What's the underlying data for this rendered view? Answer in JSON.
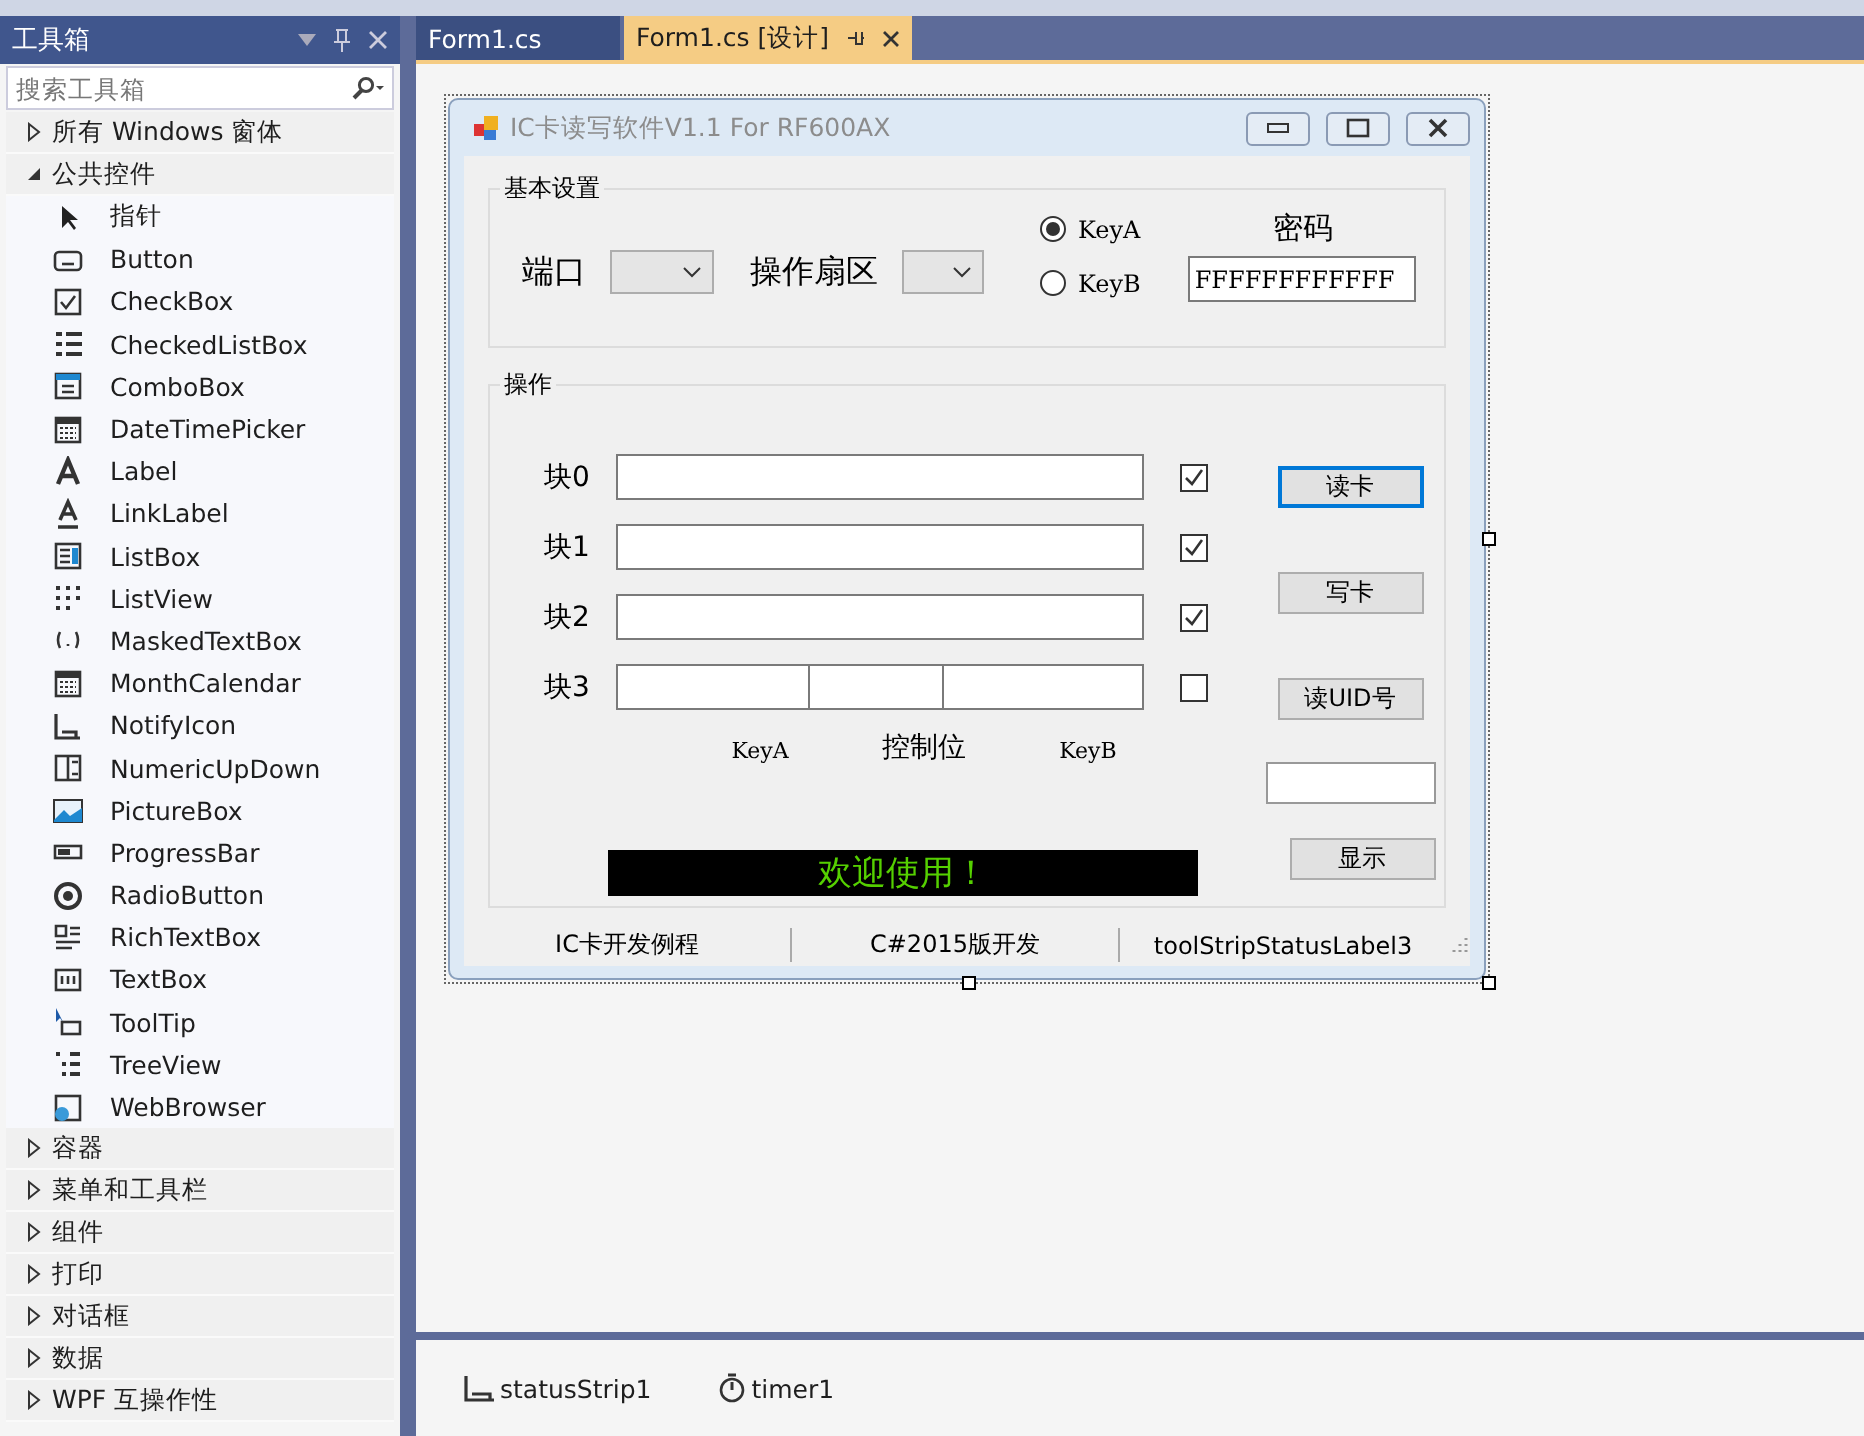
{
  "toolbox": {
    "title": "工具箱",
    "search": {
      "placeholder": "搜索工具箱"
    },
    "groups": [
      {
        "label": "所有 Windows 窗体",
        "expanded": false
      },
      {
        "label": "公共控件",
        "expanded": true,
        "items": [
          {
            "label": "指针"
          },
          {
            "label": "Button"
          },
          {
            "label": "CheckBox"
          },
          {
            "label": "CheckedListBox"
          },
          {
            "label": "ComboBox"
          },
          {
            "label": "DateTimePicker"
          },
          {
            "label": "Label"
          },
          {
            "label": "LinkLabel"
          },
          {
            "label": "ListBox"
          },
          {
            "label": "ListView"
          },
          {
            "label": "MaskedTextBox"
          },
          {
            "label": "MonthCalendar"
          },
          {
            "label": "NotifyIcon"
          },
          {
            "label": "NumericUpDown"
          },
          {
            "label": "PictureBox"
          },
          {
            "label": "ProgressBar"
          },
          {
            "label": "RadioButton"
          },
          {
            "label": "RichTextBox"
          },
          {
            "label": "TextBox"
          },
          {
            "label": "ToolTip"
          },
          {
            "label": "TreeView"
          },
          {
            "label": "WebBrowser"
          }
        ]
      },
      {
        "label": "容器",
        "expanded": false
      },
      {
        "label": "菜单和工具栏",
        "expanded": false
      },
      {
        "label": "组件",
        "expanded": false
      },
      {
        "label": "打印",
        "expanded": false
      },
      {
        "label": "对话框",
        "expanded": false
      },
      {
        "label": "数据",
        "expanded": false
      },
      {
        "label": "WPF 互操作性",
        "expanded": false
      }
    ]
  },
  "tabs": [
    {
      "label": "Form1.cs",
      "selected": false
    },
    {
      "label": "Form1.cs [设计]",
      "selected": true
    }
  ],
  "form": {
    "title": "IC卡读写软件V1.1 For RF600AX",
    "basic_settings": {
      "title": "基本设置",
      "port_label": "端口",
      "sector_label": "操作扇区",
      "key_options": [
        {
          "label": "KeyA",
          "selected": true
        },
        {
          "label": "KeyB",
          "selected": false
        }
      ],
      "password_label": "密码",
      "password_value": "FFFFFFFFFFFF"
    },
    "operation": {
      "title": "操作",
      "blocks": [
        {
          "label": "块0",
          "kind": "single",
          "checked": true
        },
        {
          "label": "块1",
          "kind": "single",
          "checked": true
        },
        {
          "label": "块2",
          "kind": "single",
          "checked": true
        },
        {
          "label": "块3",
          "kind": "split",
          "checked": false
        }
      ],
      "segment_labels": [
        "KeyA",
        "控制位",
        "KeyB"
      ],
      "buttons": [
        {
          "label": "读卡",
          "focused": true
        },
        {
          "label": "写卡",
          "focused": false
        },
        {
          "label": "读UID号",
          "focused": false
        }
      ],
      "display": "欢迎使用！",
      "show_button": "显示"
    },
    "status_strip": [
      "IC卡开发例程",
      "C#2015版开发",
      "toolStripStatusLabel3"
    ]
  },
  "tray": [
    {
      "label": "statusStrip1",
      "kind": "strip"
    },
    {
      "label": "timer1",
      "kind": "timer"
    }
  ]
}
